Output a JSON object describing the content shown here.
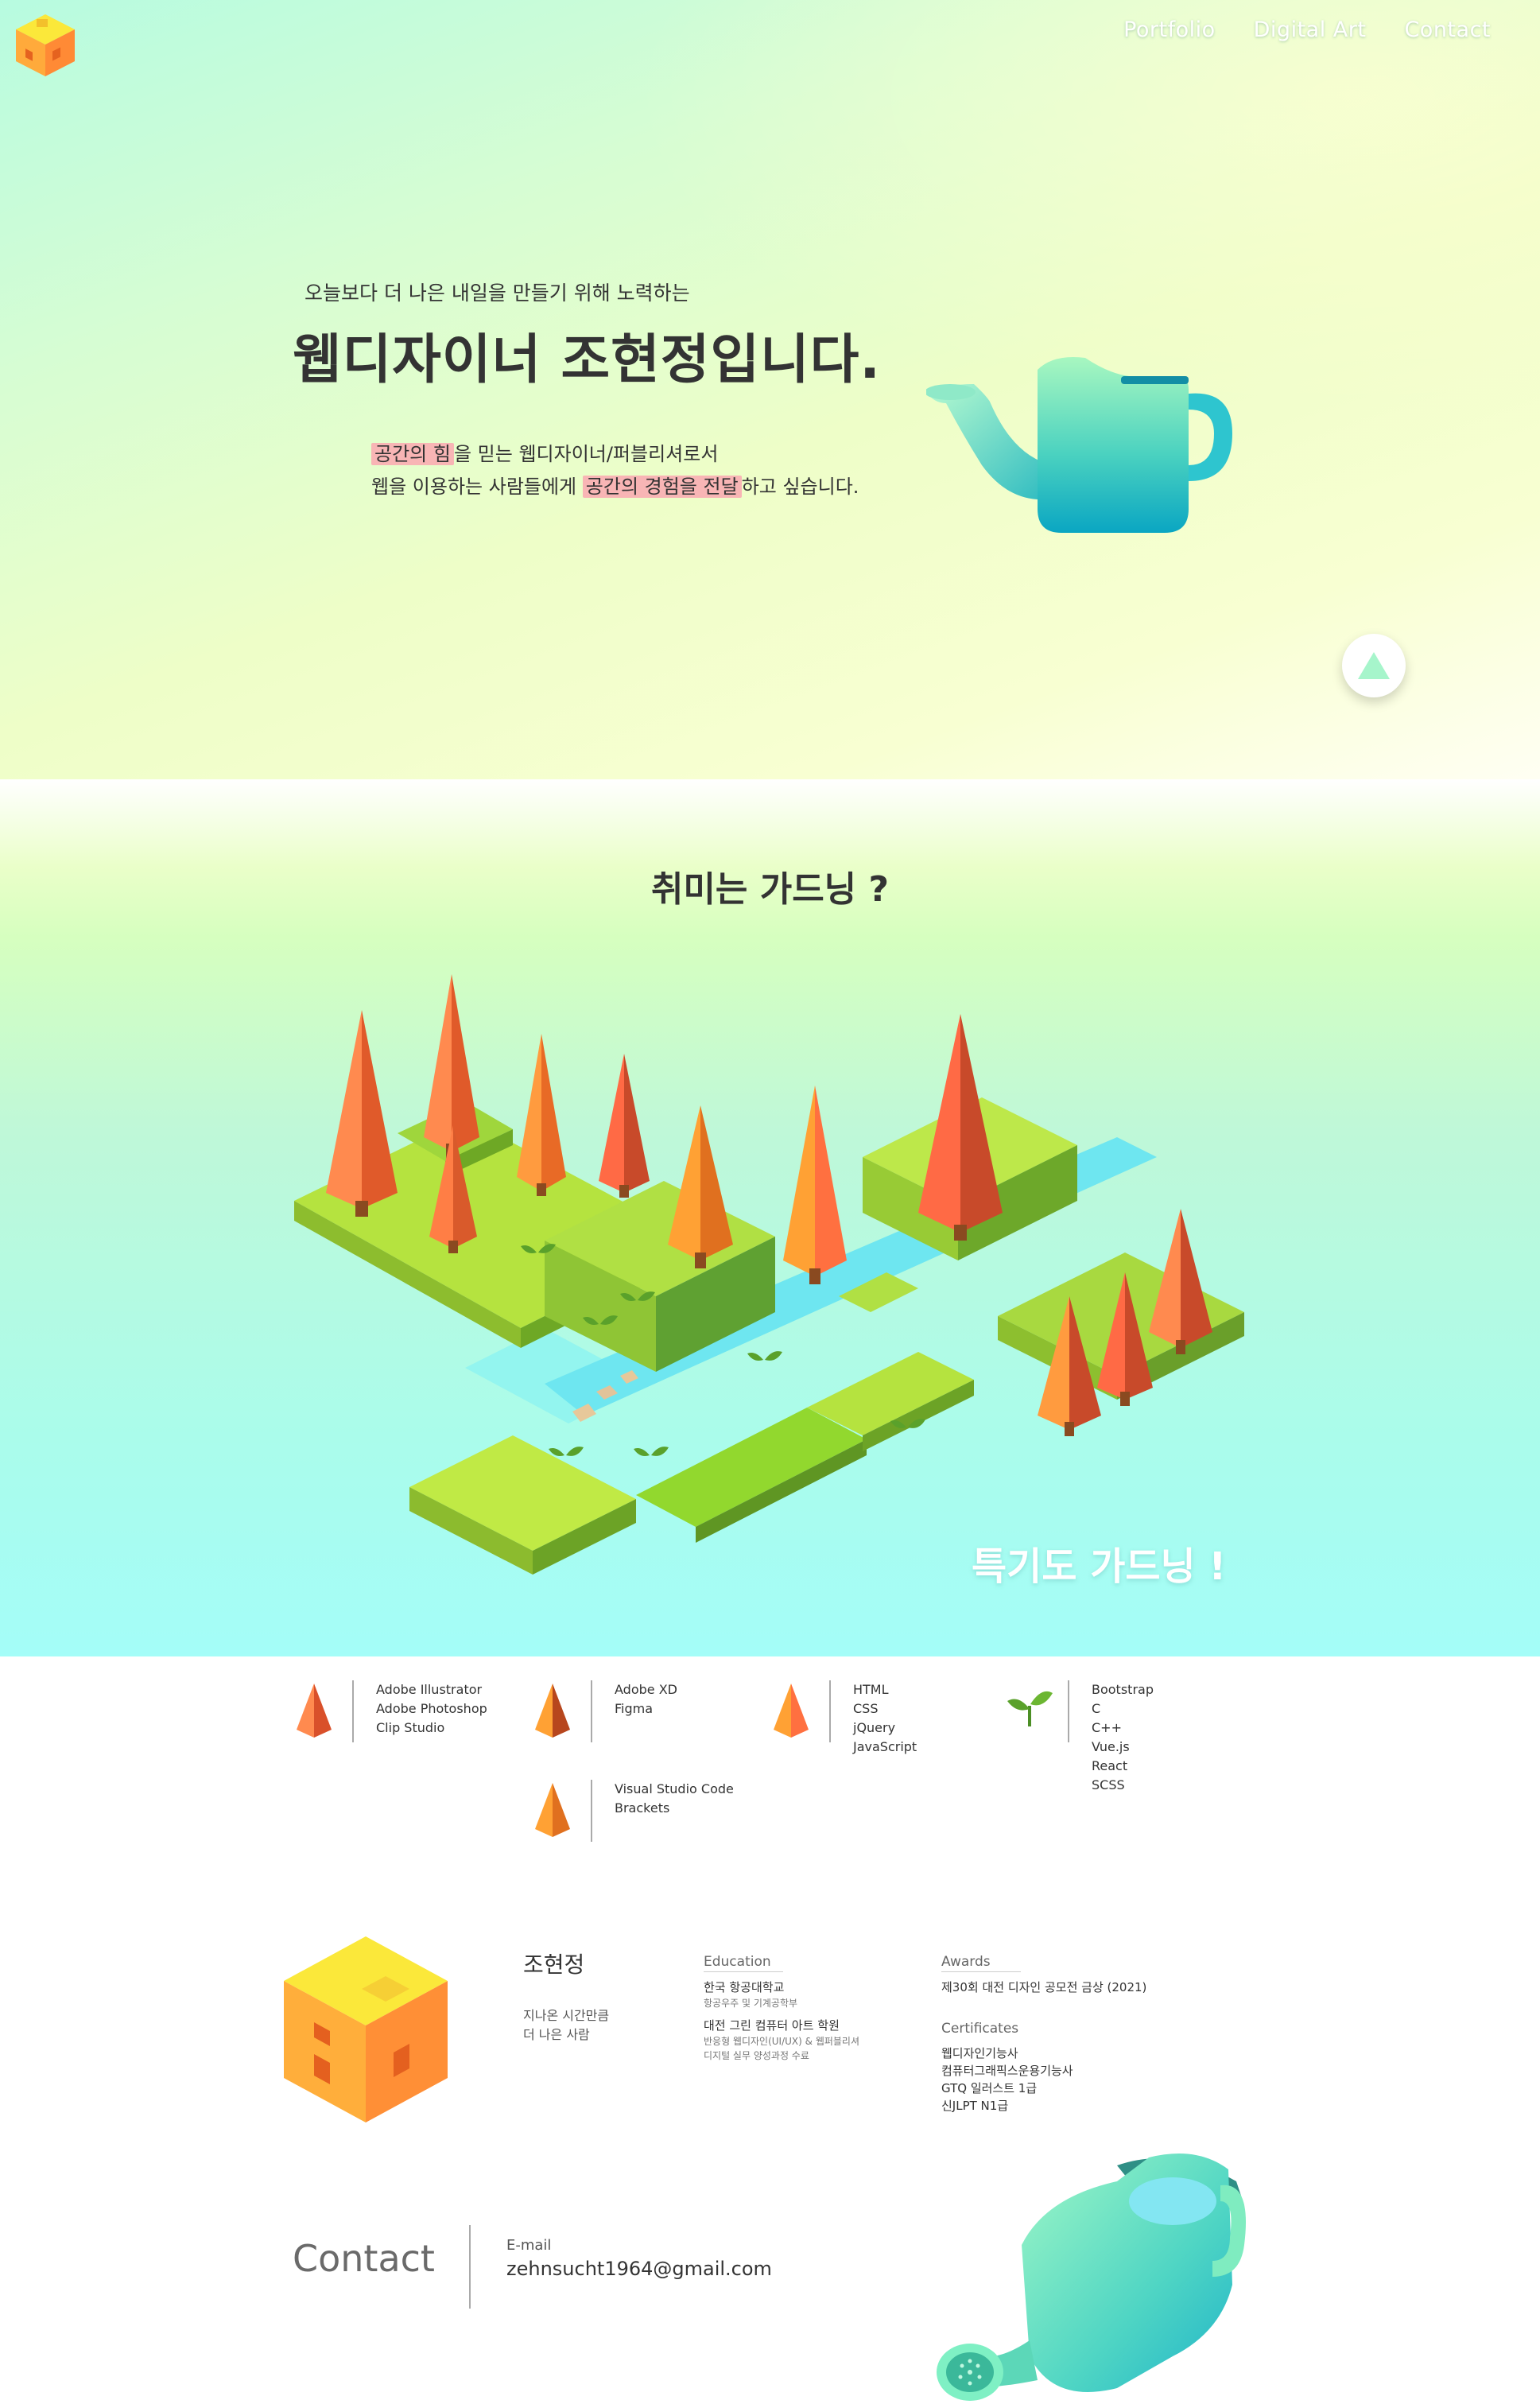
{
  "nav": {
    "items": [
      "Portfolio",
      "Digital  Art",
      "Contact"
    ]
  },
  "hero": {
    "subtitle": "오늘보다 더 나은 내일을 만들기 위해 노력하는",
    "title": "웹디자이너 조현정입니다.",
    "desc_line1_hl": "공간의 힘",
    "desc_line1_rest": "을 믿는 웹디자이너/퍼블리셔로서",
    "desc_line2_pre": "웹을 이용하는 사람들에게 ",
    "desc_line2_hl": "공간의 경험을 전달",
    "desc_line2_post": "하고 싶습니다."
  },
  "hobby": {
    "title": "취미는 가드닝 ?",
    "caption": "특기도 가드닝 !"
  },
  "skills": [
    {
      "icon": "orange-tree-icon",
      "items": [
        "Adobe Illustrator",
        "Adobe Photoshop",
        "Clip Studio"
      ]
    },
    {
      "icon": "orange-tree-icon",
      "items": [
        "Adobe XD",
        "Figma"
      ]
    },
    {
      "icon": "orange-tree-icon",
      "items": [
        "HTML",
        "CSS",
        "jQuery",
        "JavaScript"
      ]
    },
    {
      "icon": "sprout-icon",
      "items": [
        "Bootstrap",
        "C",
        "C++",
        "Vue.js",
        "React",
        "SCSS"
      ]
    },
    {
      "icon": "orange-tree-icon",
      "items": [
        "Visual Studio Code",
        "Brackets"
      ]
    }
  ],
  "profile": {
    "name": "조현정",
    "motto_line1": "지나온 시간만큼",
    "motto_line2": "더 나은 사람",
    "education": {
      "head": "Education",
      "school1": "한국 항공대학교",
      "school1_detail": "항공우주 및 기계공학부",
      "school2": "대전 그린 컴퓨터 아트 학원",
      "school2_detail1": "반응형 웹디자인(UI/UX) & 웹퍼블리셔",
      "school2_detail2": "디지털 실무 양성과정 수료"
    },
    "awards": {
      "head": "Awards",
      "item1": "제30회 대전 디자인 공모전 금상 (2021)"
    },
    "certificates": {
      "head": "Certificates",
      "items": [
        "웹디자인기능사",
        "컴퓨터그래픽스운용기능사",
        "GTQ 일러스트 1급",
        "신JLPT N1급"
      ]
    }
  },
  "contact": {
    "title": "Contact",
    "email_label": "E-mail",
    "email": "zehnsucht1964@gmail.com"
  },
  "colors": {
    "highlight": "#f8b5b5",
    "tree_orange": "#ff7a45",
    "grass_green": "#9ad43a",
    "water": "#5fe8ee",
    "kettle_teal": "#1bb0c4"
  }
}
